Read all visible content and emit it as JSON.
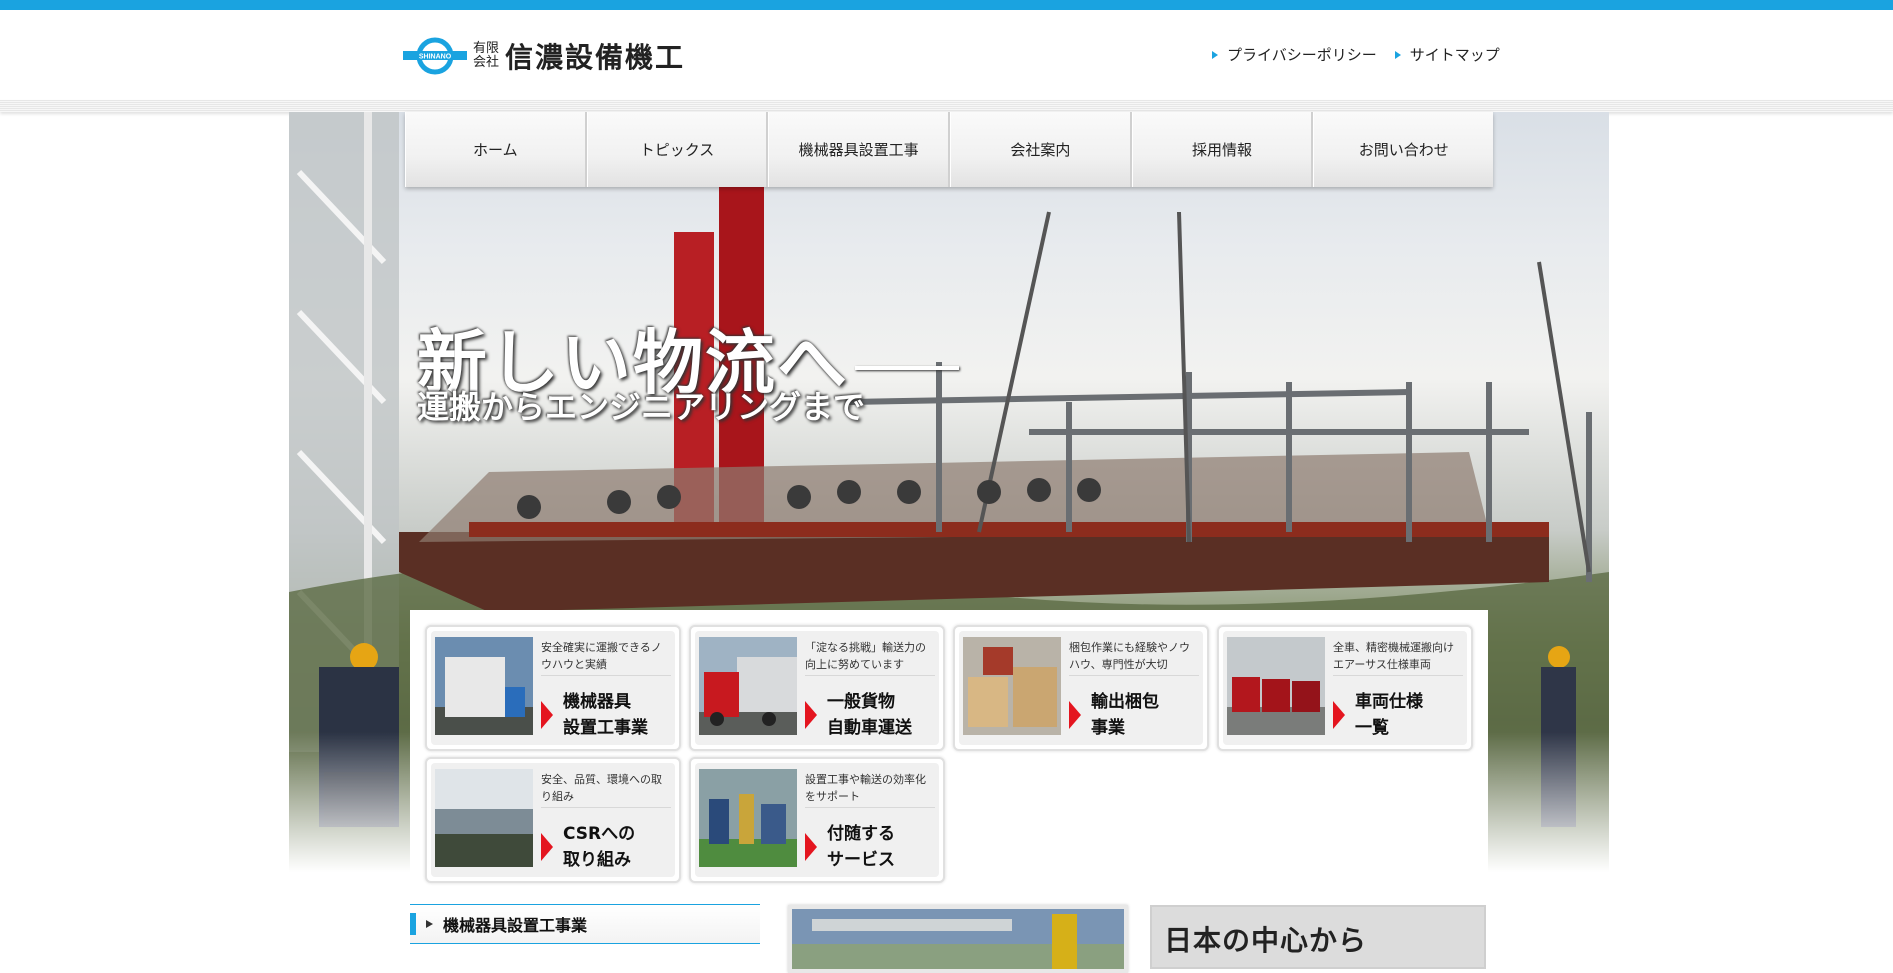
{
  "header": {
    "logo_small_top": "有限",
    "logo_small_bottom": "会社",
    "logo_main": "信濃設備機工",
    "logo_mark_text": "SHINANO",
    "util_links": [
      "プライバシーポリシー",
      "サイトマップ"
    ]
  },
  "nav": [
    "ホーム",
    "トピックス",
    "機械器具設置工事",
    "会社案内",
    "採用情報",
    "お問い合わせ"
  ],
  "hero": {
    "headline": "新しい物流へ",
    "subline": "運搬からエンジニアリングまで"
  },
  "cards": [
    {
      "desc": "安全確実に運搬できるノウハウと実績",
      "title1": "機械器具",
      "title2": "設置工事業"
    },
    {
      "desc": "「淀なる挑戦」輸送力の向上に努めています",
      "title1": "一般貨物",
      "title2": "自動車運送"
    },
    {
      "desc": "梱包作業にも経験やノウハウ、専門性が大切",
      "title1": "輸出梱包",
      "title2": "事業"
    },
    {
      "desc": "全車、精密機械運搬向けエアーサス仕様車両",
      "title1": "車両仕様",
      "title2": "一覧"
    },
    {
      "desc": "安全、品質、環境への取り組み",
      "title1": "CSRへの",
      "title2": "取り組み"
    },
    {
      "desc": "設置工事や輸送の効率化をサポート",
      "title1": "付随する",
      "title2": "サービス"
    }
  ],
  "section": {
    "heading": "機械器具設置工事業"
  },
  "side_banner": {
    "text": "日本の中心から"
  },
  "colors": {
    "accent": "#1aa3e0",
    "arrow": "#e4151f"
  }
}
